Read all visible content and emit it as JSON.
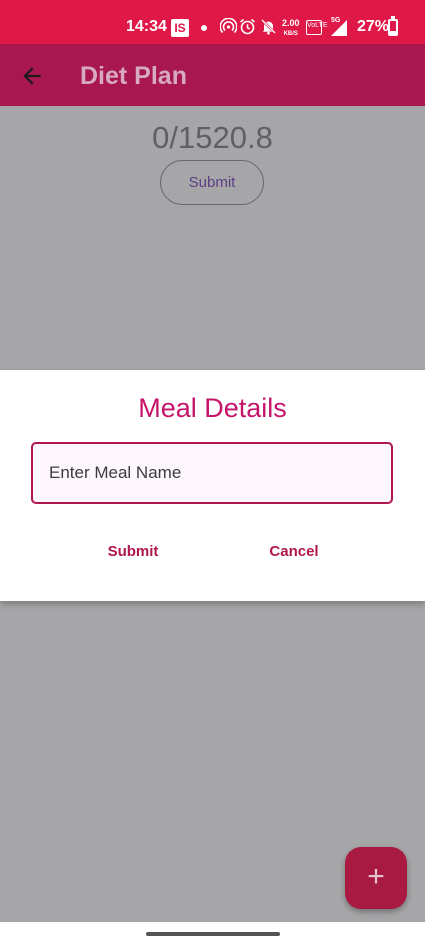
{
  "status_bar": {
    "time": "14:34",
    "app_badge": "IS",
    "speed_value": "2.00",
    "speed_unit": "KB/S",
    "volte": "VoLTE",
    "network": "5G",
    "battery_percent": "27%",
    "battery_level": 0.27,
    "icons": [
      "hotspot-icon",
      "alarm-icon",
      "bell-off-icon",
      "signal-icon",
      "battery-icon"
    ],
    "color": "#e01848"
  },
  "app_bar": {
    "title": "Diet Plan",
    "back_icon": "arrow-left-icon",
    "color": "#a8174f"
  },
  "main": {
    "calorie_counter": "0/1520.8",
    "submit_label": "Submit"
  },
  "dialog": {
    "title": "Meal Details",
    "input_placeholder": "Enter Meal Name",
    "input_value": "",
    "submit_label": "Submit",
    "cancel_label": "Cancel",
    "accent_color": "#b01750"
  },
  "fab": {
    "icon": "plus-icon",
    "glyph": "+"
  }
}
